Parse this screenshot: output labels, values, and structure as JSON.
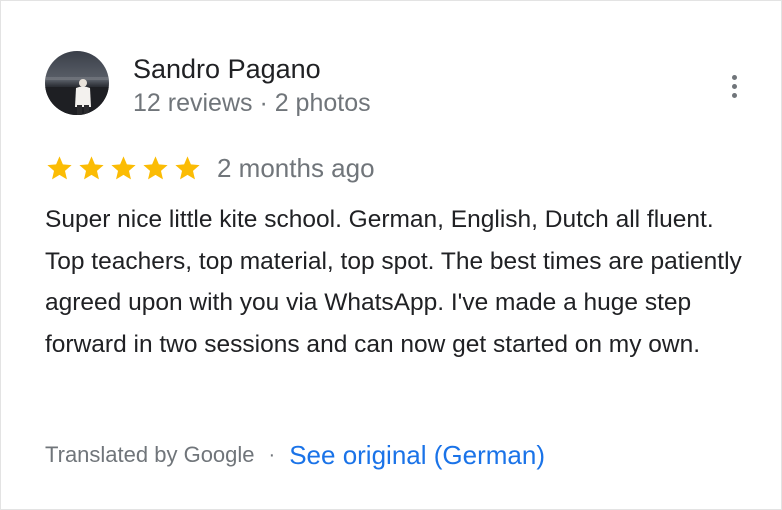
{
  "review": {
    "author": {
      "name": "Sandro Pagano",
      "meta": "12 reviews · 2 photos",
      "avatar_icon": "profile-photo"
    },
    "menu_icon": "more-vert-icon",
    "rating": {
      "stars": 5,
      "max_stars": 5,
      "star_color": "#fbbc04"
    },
    "date": "2 months ago",
    "text": "Super nice little kite school. German, English, Dutch all fluent. Top teachers, top material, top spot. The best times are patiently agreed upon with you via WhatsApp. I've made a huge step forward in two sessions and can now get started on my own.",
    "translation": {
      "translated_by": "Translated by Google",
      "separator": "·",
      "see_original": "See original (German)"
    }
  },
  "colors": {
    "primary_text": "#202124",
    "secondary_text": "#70757a",
    "link": "#1a73e8"
  }
}
